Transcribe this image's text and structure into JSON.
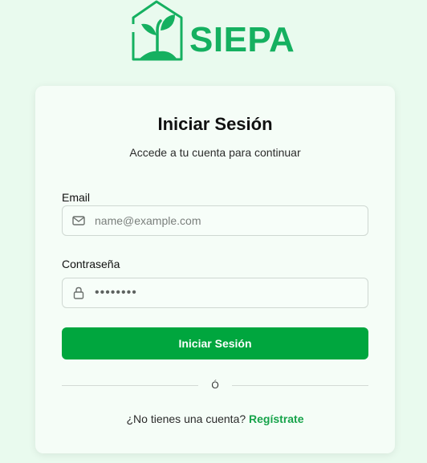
{
  "brand": {
    "name": "SIEPA",
    "color": "#15b060"
  },
  "login": {
    "title": "Iniciar Sesión",
    "subtitle": "Accede a tu cuenta para continuar",
    "email": {
      "label": "Email",
      "placeholder": "name@example.com",
      "icon": "mail-icon"
    },
    "password": {
      "label": "Contraseña",
      "value": "••••••••",
      "icon": "lock-icon"
    },
    "submit_label": "Iniciar Sesión",
    "divider_text": "Ó",
    "signup_prompt": "¿No tienes una cuenta?",
    "signup_link": "Regístrate"
  },
  "colors": {
    "primary": "#00a63e",
    "link": "#16a34a",
    "background": "#e9faee"
  }
}
